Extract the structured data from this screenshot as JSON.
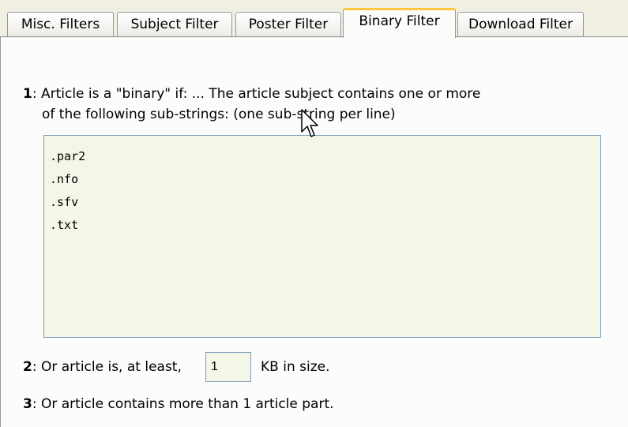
{
  "tabs": [
    {
      "label": "Misc. Filters",
      "active": false
    },
    {
      "label": "Subject Filter",
      "active": false
    },
    {
      "label": "Poster Filter",
      "active": false
    },
    {
      "label": "Binary Filter",
      "active": true
    },
    {
      "label": "Download Filter",
      "active": false
    }
  ],
  "section1": {
    "number": "1",
    "text_line1": ": Article is a \"binary\" if: ... The article subject contains one or more",
    "text_line2": "of the following sub-strings: (one sub-string per line)",
    "substrings": [
      ".par2",
      ".nfo",
      ".sfv",
      ".txt"
    ]
  },
  "section2": {
    "number": "2",
    "prefix": ": Or article is, at least,",
    "size_value": "1",
    "suffix": "KB in size."
  },
  "section3": {
    "number": "3",
    "text": ": Or article contains more than 1 article part."
  },
  "colors": {
    "active_tab_accent": "#ffc83c",
    "input_background": "#f4f7e8",
    "input_border": "#7f9db9"
  },
  "icons": [
    "mouse-pointer-icon"
  ]
}
